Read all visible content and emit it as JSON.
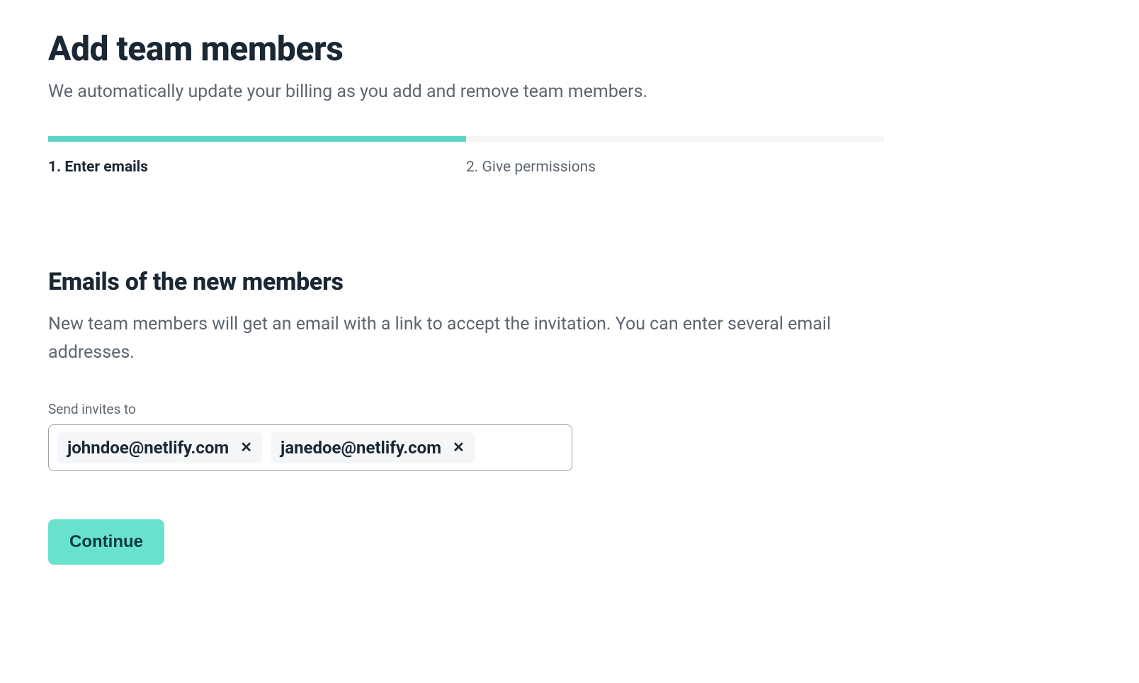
{
  "header": {
    "title": "Add team members",
    "subtitle": "We automatically update your billing as you add and remove team members."
  },
  "steps": [
    {
      "label": "1. Enter emails",
      "active": true
    },
    {
      "label": "2. Give permissions",
      "active": false
    }
  ],
  "section": {
    "title": "Emails of the new members",
    "description": "New team members will get an email with a link to accept the invitation. You can enter several email addresses."
  },
  "emailInput": {
    "label": "Send invites to",
    "chips": [
      "johndoe@netlify.com",
      "janedoe@netlify.com"
    ]
  },
  "actions": {
    "continue": "Continue"
  }
}
